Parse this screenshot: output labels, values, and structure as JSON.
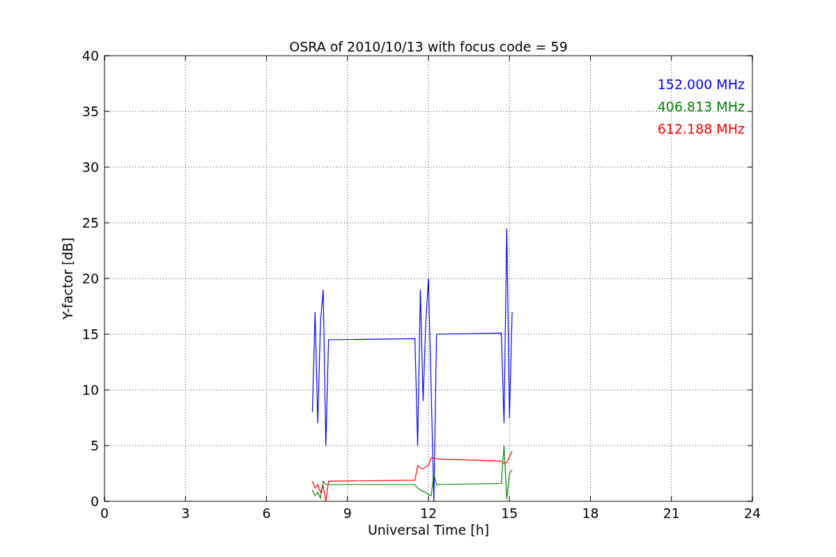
{
  "chart_data": {
    "type": "line",
    "title": "OSRA of 2010/10/13 with focus code = 59",
    "xlabel": "Universal Time [h]",
    "ylabel": "Y-factor [dB]",
    "x": [
      7.7,
      7.8,
      7.9,
      8.0,
      8.1,
      8.2,
      8.3,
      11.5,
      11.6,
      11.7,
      11.8,
      11.9,
      12.0,
      12.1,
      12.2,
      12.3,
      14.7,
      14.8,
      14.9,
      15.0,
      15.1
    ],
    "series": [
      {
        "name": "152.000 MHz",
        "color": "#0000ff",
        "values": [
          8,
          17,
          7,
          16,
          19,
          5,
          14.5,
          14.6,
          5,
          19,
          9,
          16,
          20,
          10,
          0,
          15,
          15.1,
          7,
          24.5,
          7.5,
          17
        ]
      },
      {
        "name": "406.813 MHz",
        "color": "#008000",
        "values": [
          1,
          0.5,
          0.8,
          0.3,
          1.8,
          1.5,
          1.5,
          1.5,
          1.2,
          1.0,
          0.9,
          0.8,
          0.6,
          0.5,
          2.5,
          1.5,
          1.6,
          5,
          0.2,
          2.5,
          2.8
        ]
      },
      {
        "name": "612.188 MHz",
        "color": "#ff0000",
        "values": [
          1.8,
          1.2,
          1.5,
          0.8,
          1.4,
          0,
          1.8,
          1.9,
          3.2,
          3.0,
          2.9,
          3.1,
          3.2,
          3.9,
          3.9,
          3.8,
          3.6,
          3.4,
          3.5,
          4.0,
          4.5
        ]
      }
    ],
    "xlim": [
      0,
      24
    ],
    "ylim": [
      0,
      40
    ],
    "grid": true,
    "xticks": [
      0,
      3,
      6,
      9,
      12,
      15,
      18,
      21,
      24
    ],
    "yticks": [
      0,
      5,
      10,
      15,
      20,
      25,
      30,
      35,
      40
    ]
  }
}
